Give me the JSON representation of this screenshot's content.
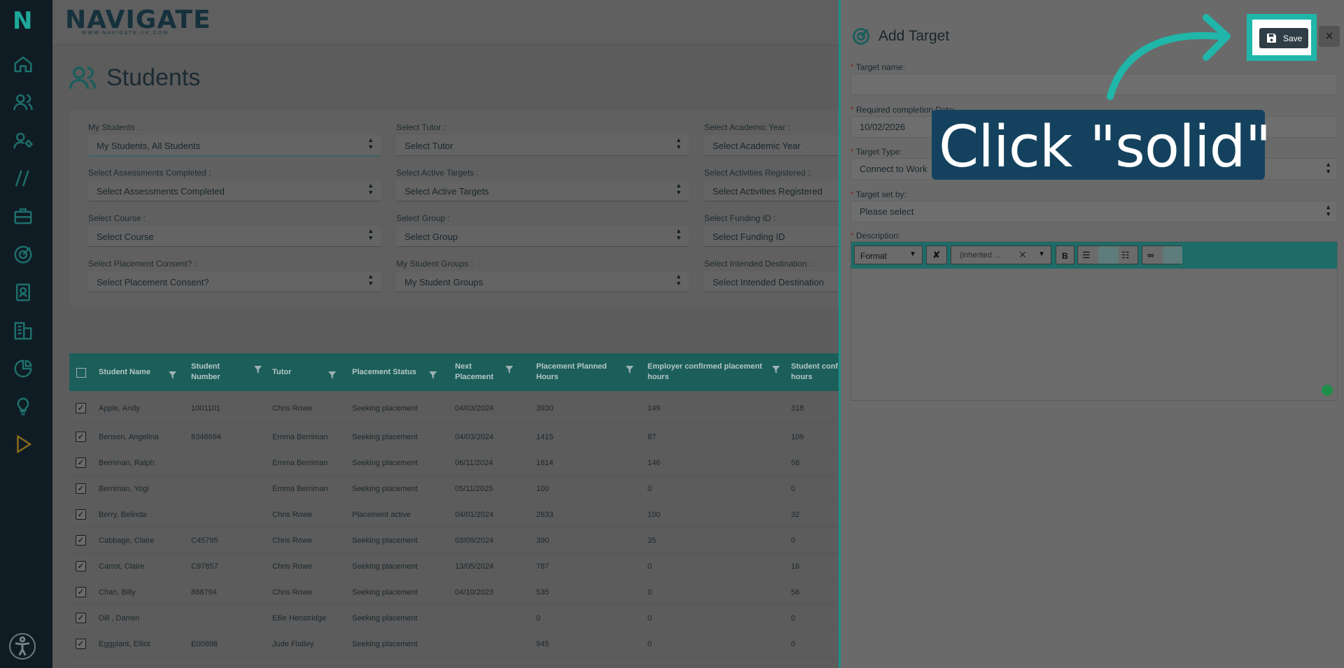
{
  "nav": {
    "logo": "N",
    "items": [
      "home-icon",
      "users-icon",
      "user-tag-icon",
      "slashes-icon",
      "briefcase-icon",
      "target-icon",
      "contacts-icon",
      "organisation-icon",
      "pie-chart-icon",
      "lightbulb-icon",
      "play-icon"
    ],
    "accessibility_icon": "accessibility-icon"
  },
  "header": {
    "brand": "NAVIGATE",
    "brand_sub": "WWW.NAVIGATE-UK.COM"
  },
  "page": {
    "title": "Students"
  },
  "filters": [
    {
      "label": "My Students :",
      "value": "My Students, All Students"
    },
    {
      "label": "Select Tutor :",
      "value": "Select Tutor"
    },
    {
      "label": "Select Academic Year :",
      "value": "Select Academic Year"
    },
    {
      "label": "Select Assessments Completed :",
      "value": "Select Assessments Completed"
    },
    {
      "label": "Select Active Targets :",
      "value": "Select Active Targets"
    },
    {
      "label": "Select Activities Registered :",
      "value": "Select Activities Registered"
    },
    {
      "label": "Select Course :",
      "value": "Select Course"
    },
    {
      "label": "Select Group :",
      "value": "Select Group"
    },
    {
      "label": "Select Funding ID :",
      "value": "Select Funding ID"
    },
    {
      "label": "Select Placement Consent? :",
      "value": "Select Placement Consent?"
    },
    {
      "label": "My Student Groups :",
      "value": "My Student Groups"
    },
    {
      "label": "Select Intended Destination :",
      "value": "Select Intended Destination"
    }
  ],
  "table": {
    "columns": [
      "Student Name",
      "Student Number",
      "Tutor",
      "Placement Status",
      "Next Placement",
      "Placement Planned Hours",
      "Employer confirmed placement hours",
      "Student confi... hours"
    ],
    "rows": [
      [
        "Apple, Andy",
        "1001101",
        "Chris Rowe",
        "Seeking placement",
        "04/03/2024",
        "3930",
        "149",
        "318"
      ],
      [
        "Benson, Angelina",
        "8348694",
        "Emma Berriman",
        "Seeking placement",
        "04/03/2024",
        "1415",
        "87",
        "109"
      ],
      [
        "Berriman, Ralph",
        "",
        "Emma Berriman",
        "Seeking placement",
        "06/11/2024",
        "1814",
        "146",
        "58"
      ],
      [
        "Berriman, Yogi",
        "",
        "Emma Berriman",
        "Seeking placement",
        "05/11/2025",
        "100",
        "0",
        "0"
      ],
      [
        "Berry, Belinda",
        "",
        "Chris Rowe",
        "Placement active",
        "04/01/2024",
        "2633",
        "100",
        "32"
      ],
      [
        "Cabbage, Claire",
        "C45795",
        "Chris Rowe",
        "Seeking placement",
        "03/09/2024",
        "390",
        "35",
        "0"
      ],
      [
        "Carrot, Claire",
        "C97857",
        "Chris Rowe",
        "Seeking placement",
        "13/05/2024",
        "787",
        "0",
        "16"
      ],
      [
        "Chan, Billy",
        "888794",
        "Chris Rowe",
        "Seeking placement",
        "04/10/2023",
        "535",
        "0",
        "56"
      ],
      [
        "Dill , Darren",
        "",
        "Ellie Henstridge",
        "Seeking placement",
        "",
        "0",
        "0",
        "0"
      ],
      [
        "Eggplant, Elliot",
        "E00898",
        "Jude Flatley",
        "Seeking placement",
        "",
        "945",
        "0",
        "0"
      ]
    ]
  },
  "drawer": {
    "title": "Add Target",
    "save_label": "Save",
    "close_label": "×",
    "fields": {
      "target_name_label": "Target name:",
      "target_name_value": "",
      "completion_label": "Required completion Date:",
      "completion_value": "10/02/2026",
      "type_label": "Target Type:",
      "type_value": "Connect to Work",
      "set_by_label": "Target set by:",
      "set_by_value": "Please select",
      "description_label": "Description:"
    },
    "editor": {
      "format_label": "Format",
      "style_label": "(inherited ...",
      "bold_label": "B"
    }
  },
  "callout": {
    "text": "Click \"solid\""
  },
  "colors": {
    "accent": "#20b6a9",
    "callout_bg": "#14425e",
    "table_header": "#1b5e5a"
  }
}
